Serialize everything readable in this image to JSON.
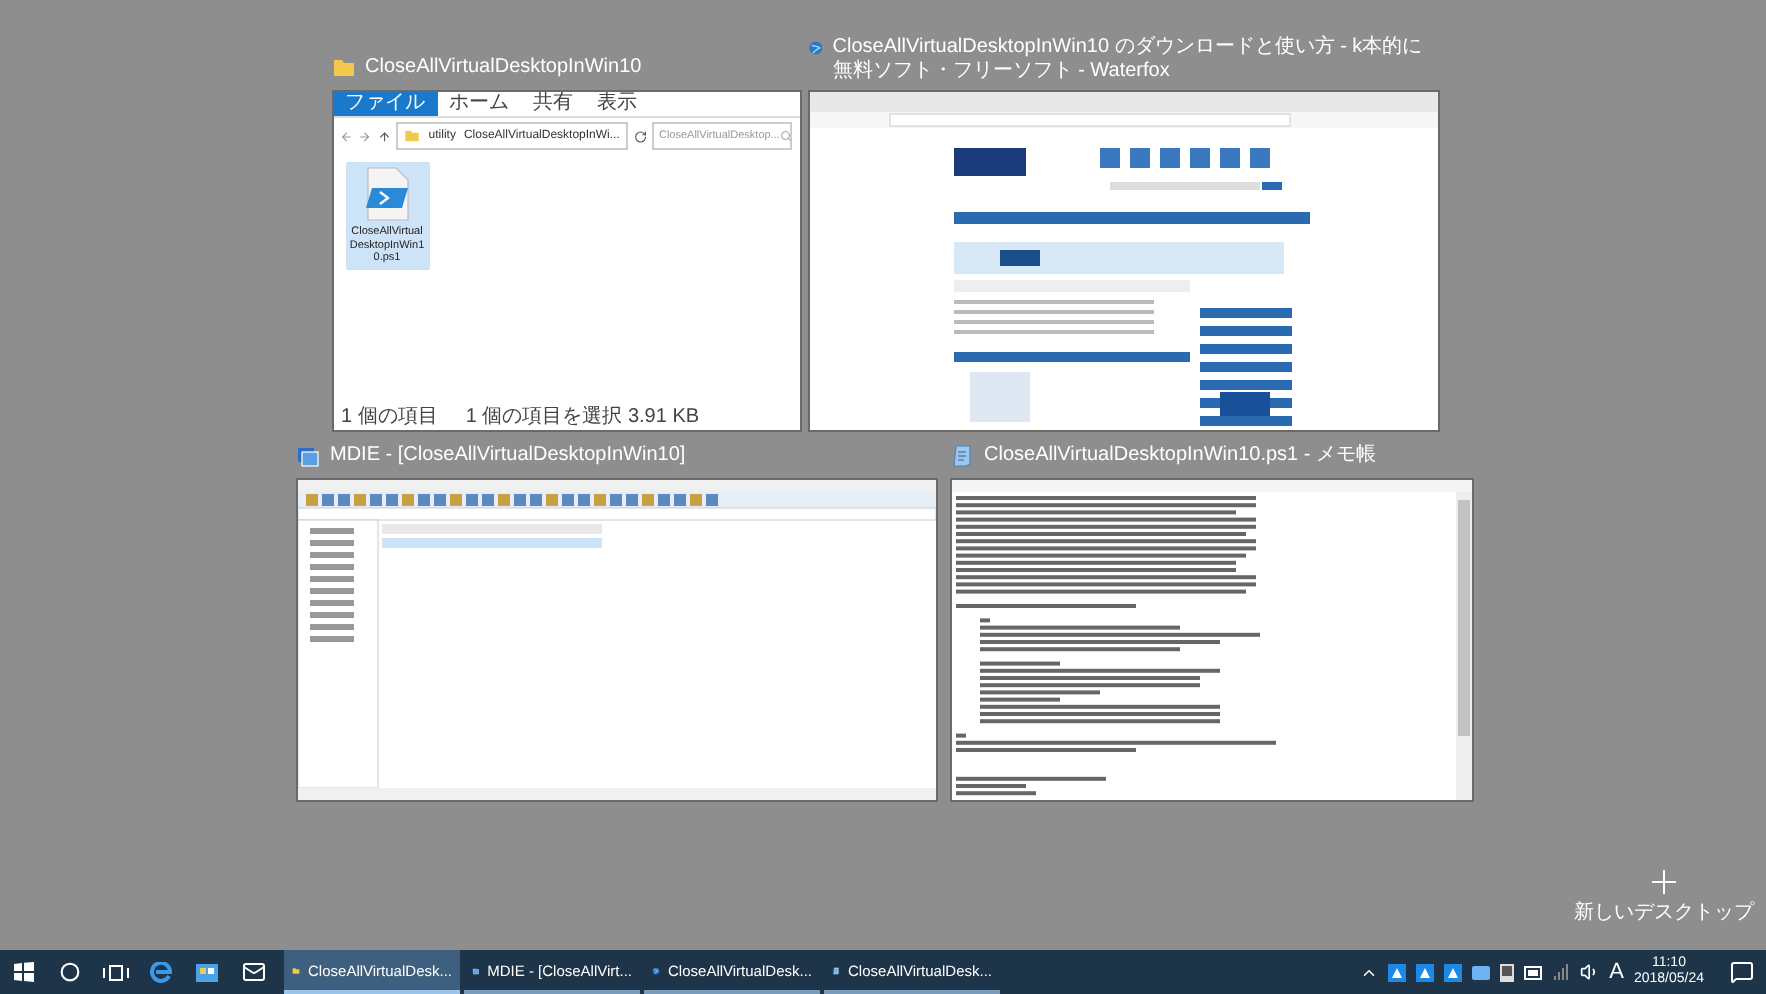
{
  "windows": [
    {
      "kind": "explorer",
      "title": "CloseAllVirtualDesktopInWin10",
      "ribbon_tabs": [
        {
          "label": "ファイル",
          "selected": true
        },
        {
          "label": "ホーム",
          "selected": false
        },
        {
          "label": "共有",
          "selected": false
        },
        {
          "label": "表示",
          "selected": false
        }
      ],
      "path": [
        "utility",
        "CloseAllVirtualDesktopInWi..."
      ],
      "search": {
        "placeholder": "CloseAllVirtualDesktop..."
      },
      "file": {
        "name": "CloseAllVirtualDesktopInWin10.ps1",
        "selected": true
      },
      "status": [
        "1 個の項目",
        "1 個の項目を選択 3.91 KB"
      ]
    },
    {
      "kind": "browser",
      "title": "CloseAllVirtualDesktopInWin10 のダウンロードと使い方 - k本的に無料ソフト・フリーソフト - Waterfox"
    },
    {
      "kind": "mdie",
      "title": "MDIE - [CloseAllVirtualDesktopInWin10]"
    },
    {
      "kind": "notepad",
      "title": "CloseAllVirtualDesktopInWin10.ps1 - メモ帳"
    }
  ],
  "new_desktop": {
    "label": "新しいデスクトップ"
  },
  "taskbar": {
    "apps": [
      {
        "kind": "explorer",
        "label": "CloseAllVirtualDesk...",
        "selected": true
      },
      {
        "kind": "mdie",
        "label": "MDIE - [CloseAllVirt...",
        "selected": false
      },
      {
        "kind": "browser",
        "label": "CloseAllVirtualDesk...",
        "selected": false
      },
      {
        "kind": "notepad",
        "label": "CloseAllVirtualDesk...",
        "selected": false
      }
    ],
    "ime": "A",
    "time": "11:10",
    "date": "2018/05/24"
  }
}
